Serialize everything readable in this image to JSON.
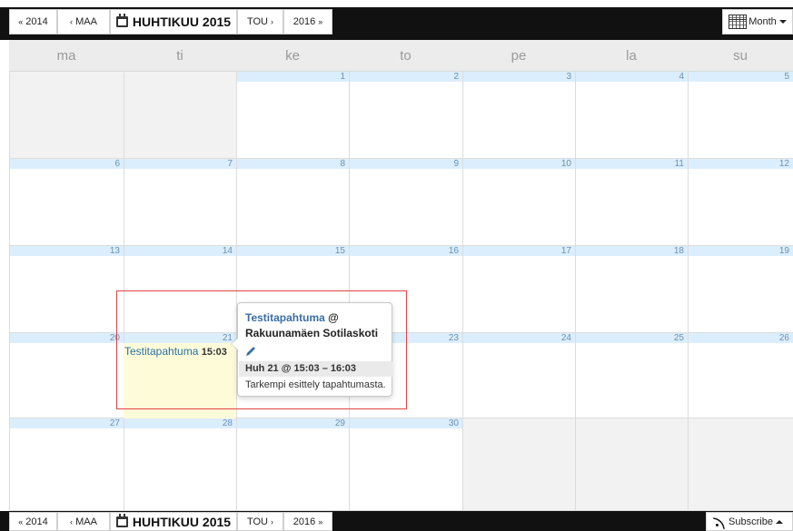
{
  "nav": {
    "prev_year": "2014",
    "prev_month": "MAA",
    "title": "HUHTIKUU 2015",
    "next_month": "TOU",
    "next_year": "2016",
    "view_label": "Month",
    "subscribe_label": "Subscribe"
  },
  "weekdays": [
    "ma",
    "ti",
    "ke",
    "to",
    "pe",
    "la",
    "su"
  ],
  "weeks": [
    [
      "",
      "",
      "1",
      "2",
      "3",
      "4",
      "5"
    ],
    [
      "6",
      "7",
      "8",
      "9",
      "10",
      "11",
      "12"
    ],
    [
      "13",
      "14",
      "15",
      "16",
      "17",
      "18",
      "19"
    ],
    [
      "20",
      "21",
      "22",
      "23",
      "24",
      "25",
      "26"
    ],
    [
      "27",
      "28",
      "29",
      "30",
      "",
      "",
      ""
    ]
  ],
  "event": {
    "title": "Testitapahtuma",
    "time": "15:03",
    "day": "21"
  },
  "tooltip": {
    "title": "Testitapahtuma",
    "at": "@",
    "location": "Rakuunamäen Sotilaskoti",
    "time": "Huh 21 @ 15:03 – 16:03",
    "description": "Tarkempi esittely tapahtumasta."
  },
  "colors": {
    "link": "#3a6ea5",
    "day_header_bg": "#dbeefd",
    "event_bg": "#fefcd8",
    "highlight_border": "#e04343"
  }
}
